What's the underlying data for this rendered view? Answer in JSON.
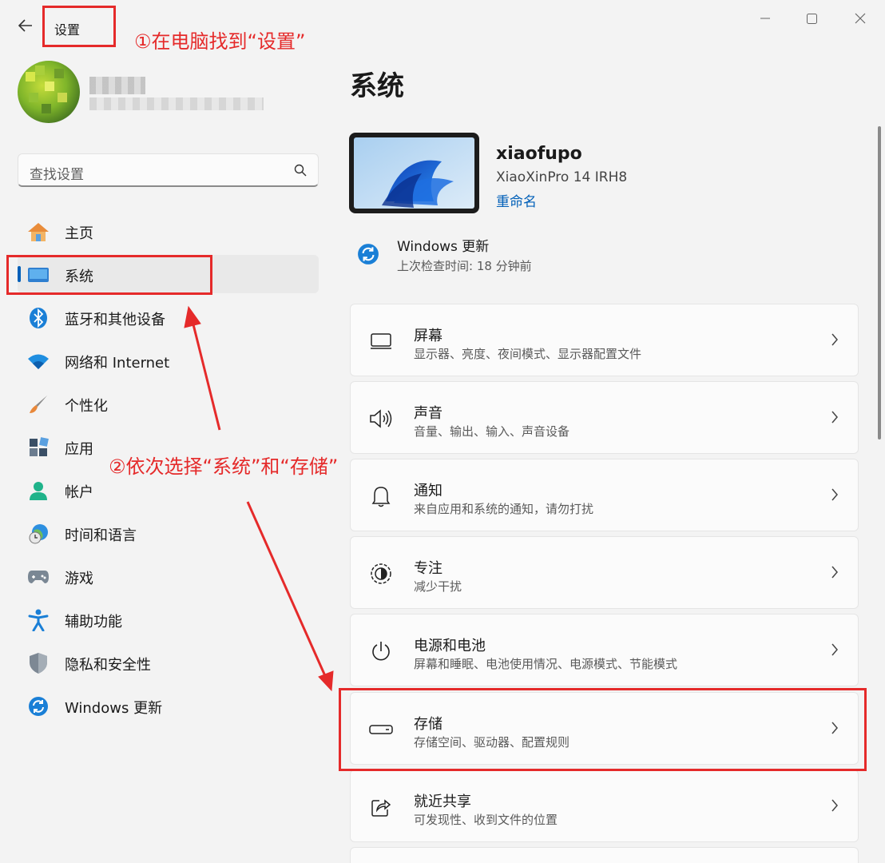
{
  "window": {
    "title": "设置",
    "controls": [
      "minimize-icon",
      "maximize-icon",
      "close-icon"
    ]
  },
  "search": {
    "placeholder": "查找设置",
    "icon": "search-icon"
  },
  "nav": {
    "items": [
      {
        "label": "主页",
        "icon": "home-icon"
      },
      {
        "label": "系统",
        "icon": "system-monitor-icon",
        "active": true
      },
      {
        "label": "蓝牙和其他设备",
        "icon": "bluetooth-icon"
      },
      {
        "label": "网络和 Internet",
        "icon": "wifi-icon"
      },
      {
        "label": "个性化",
        "icon": "brush-icon"
      },
      {
        "label": "应用",
        "icon": "apps-icon"
      },
      {
        "label": "帐户",
        "icon": "account-icon"
      },
      {
        "label": "时间和语言",
        "icon": "globe-clock-icon"
      },
      {
        "label": "游戏",
        "icon": "gamepad-icon"
      },
      {
        "label": "辅助功能",
        "icon": "accessibility-icon"
      },
      {
        "label": "隐私和安全性",
        "icon": "shield-icon"
      },
      {
        "label": "Windows 更新",
        "icon": "sync-icon"
      }
    ]
  },
  "main": {
    "title": "系统",
    "device": {
      "name": "xiaofupo",
      "model": "XiaoXinPro 14 IRH8",
      "rename": "重命名"
    },
    "update": {
      "title": "Windows 更新",
      "subtitle": "上次检查时间: 18 分钟前"
    },
    "cards": [
      {
        "title": "屏幕",
        "subtitle": "显示器、亮度、夜间模式、显示器配置文件",
        "icon": "display-icon"
      },
      {
        "title": "声音",
        "subtitle": "音量、输出、输入、声音设备",
        "icon": "speaker-icon"
      },
      {
        "title": "通知",
        "subtitle": "来自应用和系统的通知，请勿打扰",
        "icon": "bell-icon"
      },
      {
        "title": "专注",
        "subtitle": "减少干扰",
        "icon": "focus-icon"
      },
      {
        "title": "电源和电池",
        "subtitle": "屏幕和睡眠、电池使用情况、电源模式、节能模式",
        "icon": "power-icon"
      },
      {
        "title": "存储",
        "subtitle": "存储空间、驱动器、配置规则",
        "icon": "storage-icon"
      },
      {
        "title": "就近共享",
        "subtitle": "可发现性、收到文件的位置",
        "icon": "share-icon"
      }
    ]
  },
  "annotations": {
    "step1": "①在电脑找到“设置”",
    "step2": "②依次选择“系统”和“存储”",
    "color": "#e52a2a"
  },
  "colors": {
    "accent": "#005fb8",
    "background": "#f3f3f3",
    "card": "#fbfbfb"
  }
}
